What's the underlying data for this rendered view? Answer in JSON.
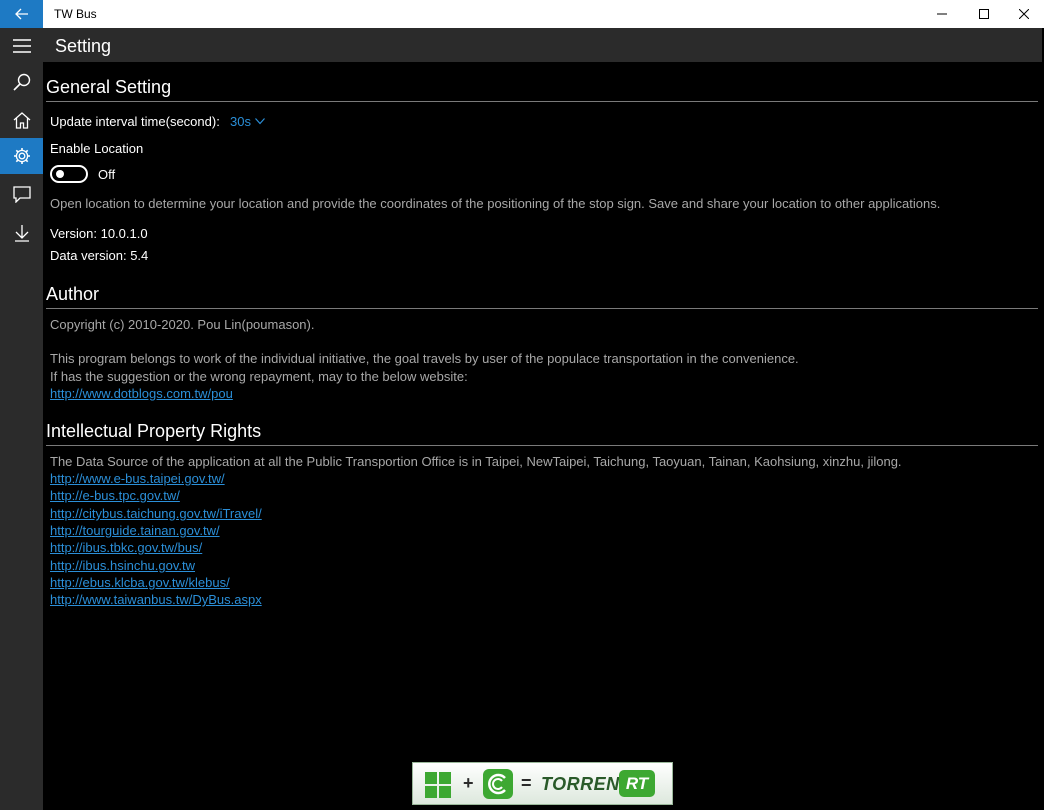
{
  "window": {
    "title": "TW Bus"
  },
  "header": {
    "title": "Setting"
  },
  "rail": {
    "items": [
      {
        "icon": "hamburger-menu-icon"
      },
      {
        "icon": "search-icon"
      },
      {
        "icon": "home-icon"
      },
      {
        "icon": "gear-icon"
      },
      {
        "icon": "chat-bubble-icon"
      },
      {
        "icon": "download-icon"
      }
    ],
    "active_color": "#1e7ac4"
  },
  "general": {
    "heading": "General Setting",
    "interval_label": "Update interval time(second):",
    "interval_value": "30s",
    "location_label": "Enable Location",
    "toggle_state": "Off",
    "location_desc": "Open location to determine your location and provide the coordinates of the positioning of the stop sign. Save and share your location to other applications.",
    "version": "Version: 10.0.1.0",
    "data_version": "Data version: 5.4"
  },
  "author": {
    "heading": "Author",
    "copyright": "Copyright (c) 2010-2020. Pou Lin(poumason).",
    "desc_line1": "This program belongs to work of the individual initiative, the goal travels by user of the populace transportation in the convenience.",
    "desc_line2": "If has the suggestion or the wrong repayment, may to the below website:",
    "website": "http://www.dotblogs.com.tw/pou"
  },
  "ipr": {
    "heading": "Intellectual Property Rights",
    "desc": "The Data Source of the application at all the Public Transportion Office is in Taipei, NewTaipei, Taichung, Taoyuan, Tainan, Kaohsiung, xinzhu, jilong.",
    "links": [
      "http://www.e-bus.taipei.gov.tw/",
      "http://e-bus.tpc.gov.tw/",
      "http://citybus.taichung.gov.tw/iTravel/",
      "http://tourguide.tainan.gov.tw/",
      "http://ibus.tbkc.gov.tw/bus/",
      "http://ibus.hsinchu.gov.tw",
      "http://ebus.klcba.gov.tw/klebus/",
      "http://www.taiwanbus.tw/DyBus.aspx"
    ]
  },
  "ad": {
    "plus": "+",
    "equals": "=",
    "word": "TORRENT",
    "badge": "RT"
  },
  "colors": {
    "accent": "#1e7ac4",
    "link": "#2b8fd8",
    "chrome": "#2b2b2b"
  }
}
